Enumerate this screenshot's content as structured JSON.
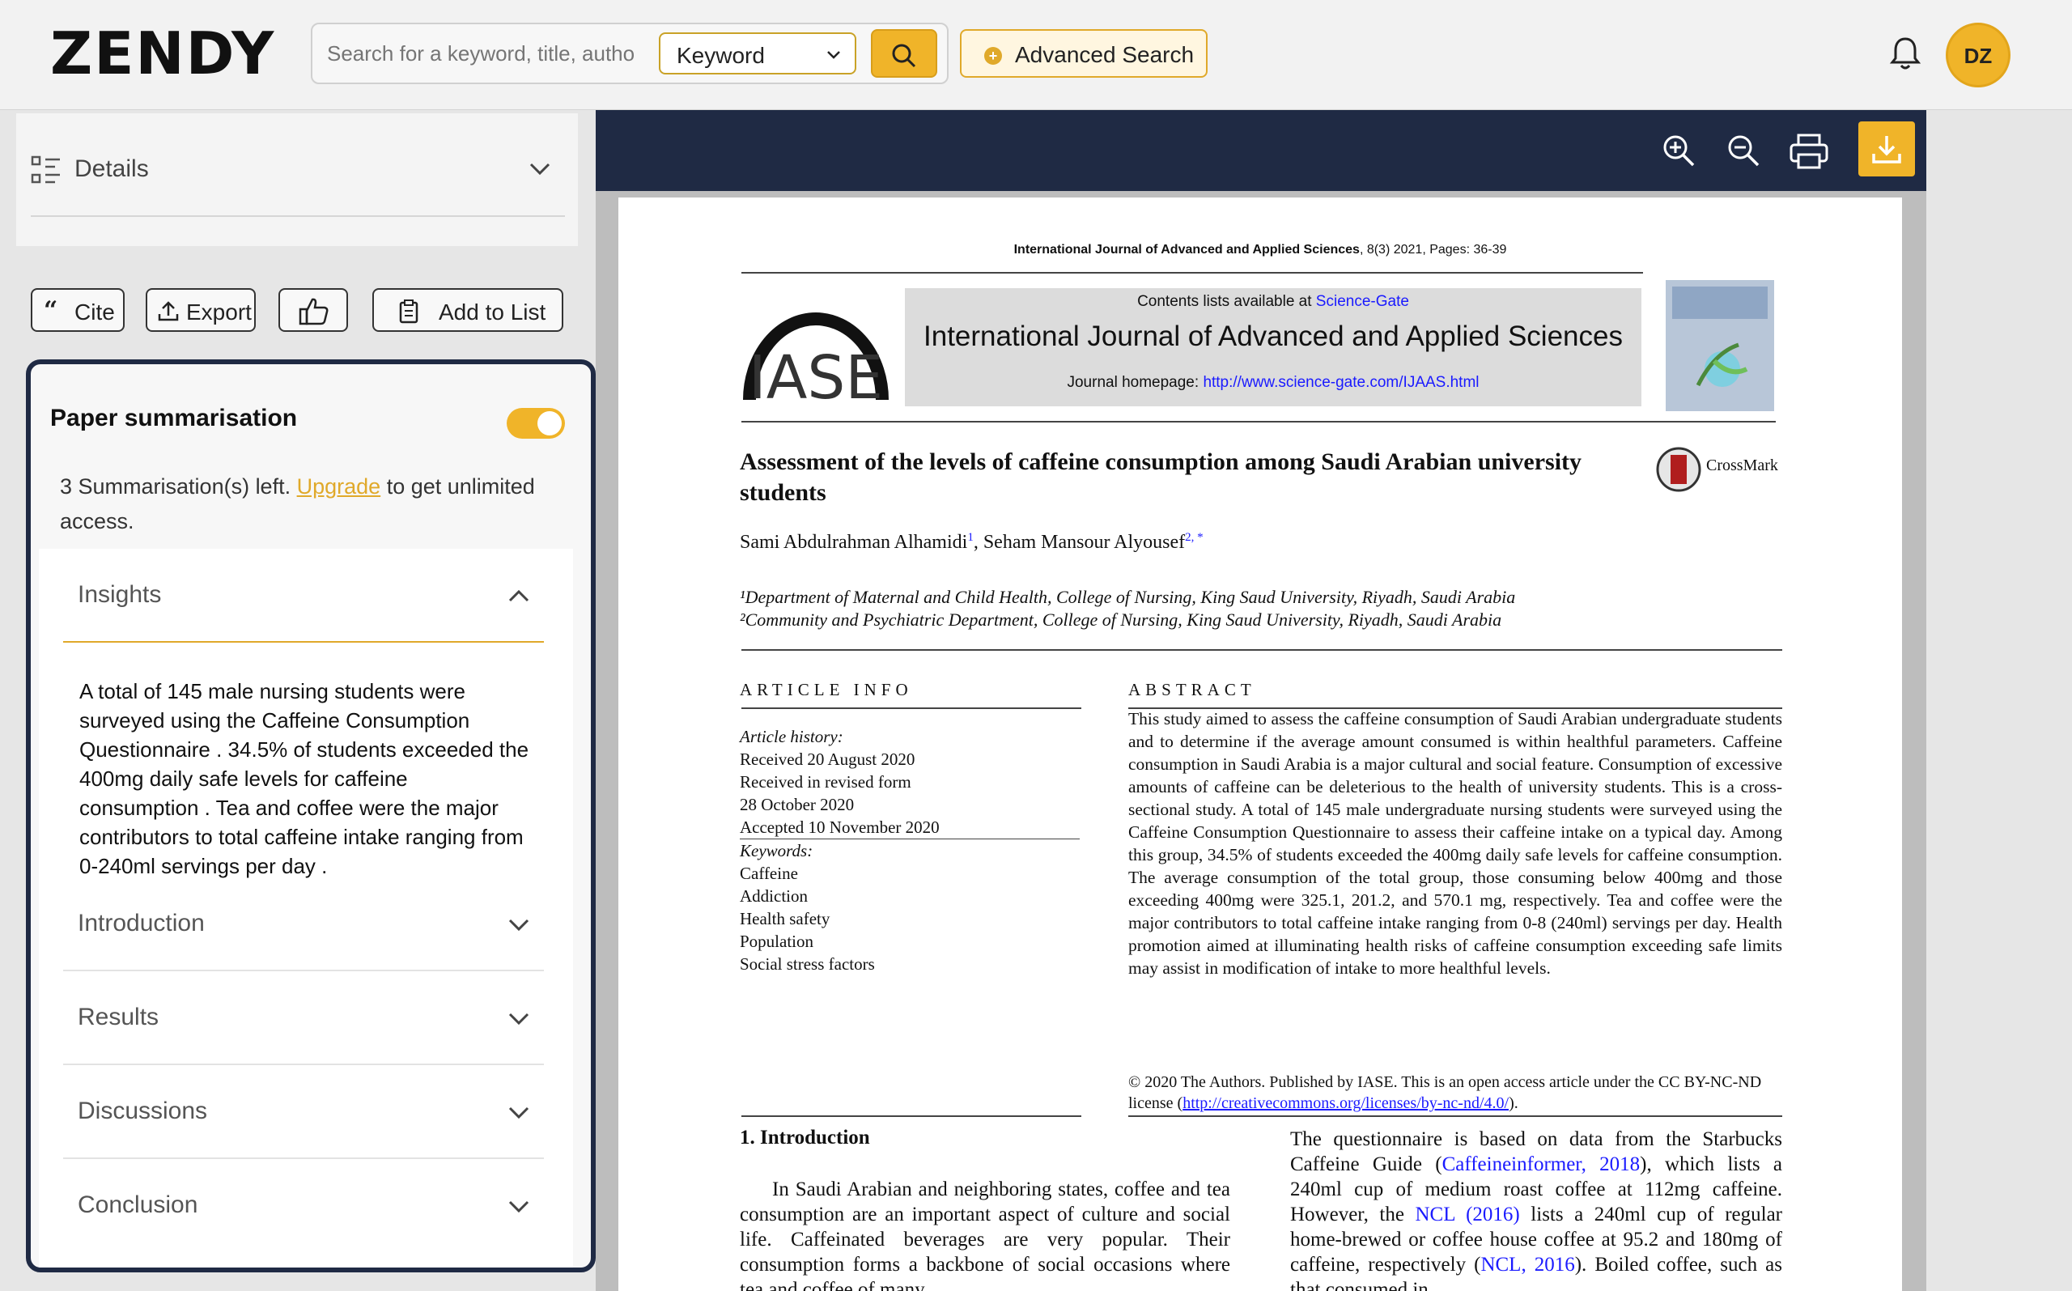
{
  "header": {
    "logo": "ZENDY",
    "search_placeholder": "Search for a keyword, title, author",
    "search_mode": "Keyword",
    "advanced_search_label": "Advanced Search",
    "avatar_initials": "DZ"
  },
  "sidebar": {
    "details_label": "Details",
    "actions": {
      "cite": "Cite",
      "export": "Export",
      "add_to_list": "Add to List"
    }
  },
  "summary": {
    "title": "Paper summarisation",
    "toggle_on": true,
    "remaining_prefix": "3 Summarisation(s) left.",
    "upgrade_link": "Upgrade",
    "remaining_suffix": "to get unlimited access.",
    "sections": [
      {
        "label": "Insights",
        "expanded": true
      },
      {
        "label": "Introduction",
        "expanded": false
      },
      {
        "label": "Results",
        "expanded": false
      },
      {
        "label": "Discussions",
        "expanded": false
      },
      {
        "label": "Conclusion",
        "expanded": false
      }
    ],
    "insights_text": "A total of 145 male nursing students were surveyed using the Caffeine Consumption Questionnaire . 34.5% of students exceeded the 400mg daily safe levels for caffeine consumption . Tea and coffee were the major contributors to total caffeine intake ranging from 0-240ml servings per day ."
  },
  "paper": {
    "journal_line": "International Journal of Advanced and Applied Sciences",
    "journal_line_suffix": ", 8(3) 2021, Pages: 36-39",
    "logo_text": "IASE",
    "contents_prefix": "Contents lists available at ",
    "contents_link": "Science-Gate",
    "journal_name": "International Journal of Advanced and Applied Sciences",
    "homepage_prefix": "Journal homepage: ",
    "homepage_link": "http://www.science-gate.com/IJAAS.html",
    "crossmark": "CrossMark",
    "title": "Assessment of the levels of caffeine consumption among Saudi Arabian university students",
    "author1": "Sami Abdulrahman Alhamidi",
    "author1_sup": "1",
    "author2": ", Seham Mansour Alyousef",
    "author2_sup": "2, *",
    "affil1": "¹Department of Maternal and Child Health, College of Nursing, King Saud University, Riyadh, Saudi Arabia",
    "affil2": "²Community and Psychiatric Department, College of Nursing, King Saud University, Riyadh, Saudi Arabia",
    "article_info_head": "ARTICLE INFO",
    "abstract_head": "ABSTRACT",
    "history_label": "Article history:",
    "history": [
      "Received 20 August 2020",
      "Received in revised form",
      "28 October 2020",
      "Accepted 10 November 2020"
    ],
    "keywords_label": "Keywords:",
    "keywords": [
      "Caffeine",
      "Addiction",
      "Health safety",
      "Population",
      "Social stress factors"
    ],
    "abstract": "This study aimed to assess the caffeine consumption of Saudi Arabian undergraduate students and to determine if the average amount consumed is within healthful parameters. Caffeine consumption in Saudi Arabia is a major cultural and social feature. Consumption of excessive amounts of caffeine can be deleterious to the health of university students. This is a cross-sectional study. A total of 145 male undergraduate nursing students were surveyed using the Caffeine Consumption Questionnaire to assess their caffeine intake on a typical day. Among this group, 34.5% of students exceeded the 400mg daily safe levels for caffeine consumption. The average consumption of the total group, those consuming below 400mg and those exceeding 400mg were 325.1, 201.2, and 570.1 mg, respectively. Tea and coffee were the major contributors to total caffeine intake ranging from 0-8 (240ml) servings per day. Health promotion aimed at illuminating health risks of caffeine consumption exceeding safe limits may assist in modification of intake to more healthful levels.",
    "copyright_prefix": "© 2020 The Authors. Published by IASE. This is an open access article under the CC BY-NC-ND license (",
    "copyright_link": "http://creativecommons.org/licenses/by-nc-nd/4.0/",
    "copyright_suffix": ").",
    "intro_heading": "1. Introduction",
    "intro_col1": "In Saudi Arabian and neighboring states, coffee and tea consumption are an important aspect of culture and social life. Caffeinated beverages are very popular. Their consumption forms a backbone of social occasions where tea and coffee of many",
    "intro_col2_a": "The questionnaire is based on data from the Starbucks Caffeine Guide (",
    "intro_col2_link1": "Caffeineinformer, 2018",
    "intro_col2_b": "), which lists a 240ml cup of medium roast coffee at 112mg caffeine. However, the ",
    "intro_col2_link2": "NCL (2016)",
    "intro_col2_c": " lists a 240ml cup of regular home-brewed or coffee house coffee at 95.2 and 180mg of caffeine, respectively (",
    "intro_col2_link3": "NCL, 2016",
    "intro_col2_d": "). Boiled coffee, such as that consumed in"
  },
  "colors": {
    "accent": "#f0b429",
    "navy": "#1f2a44",
    "link": "#1a1aff"
  }
}
